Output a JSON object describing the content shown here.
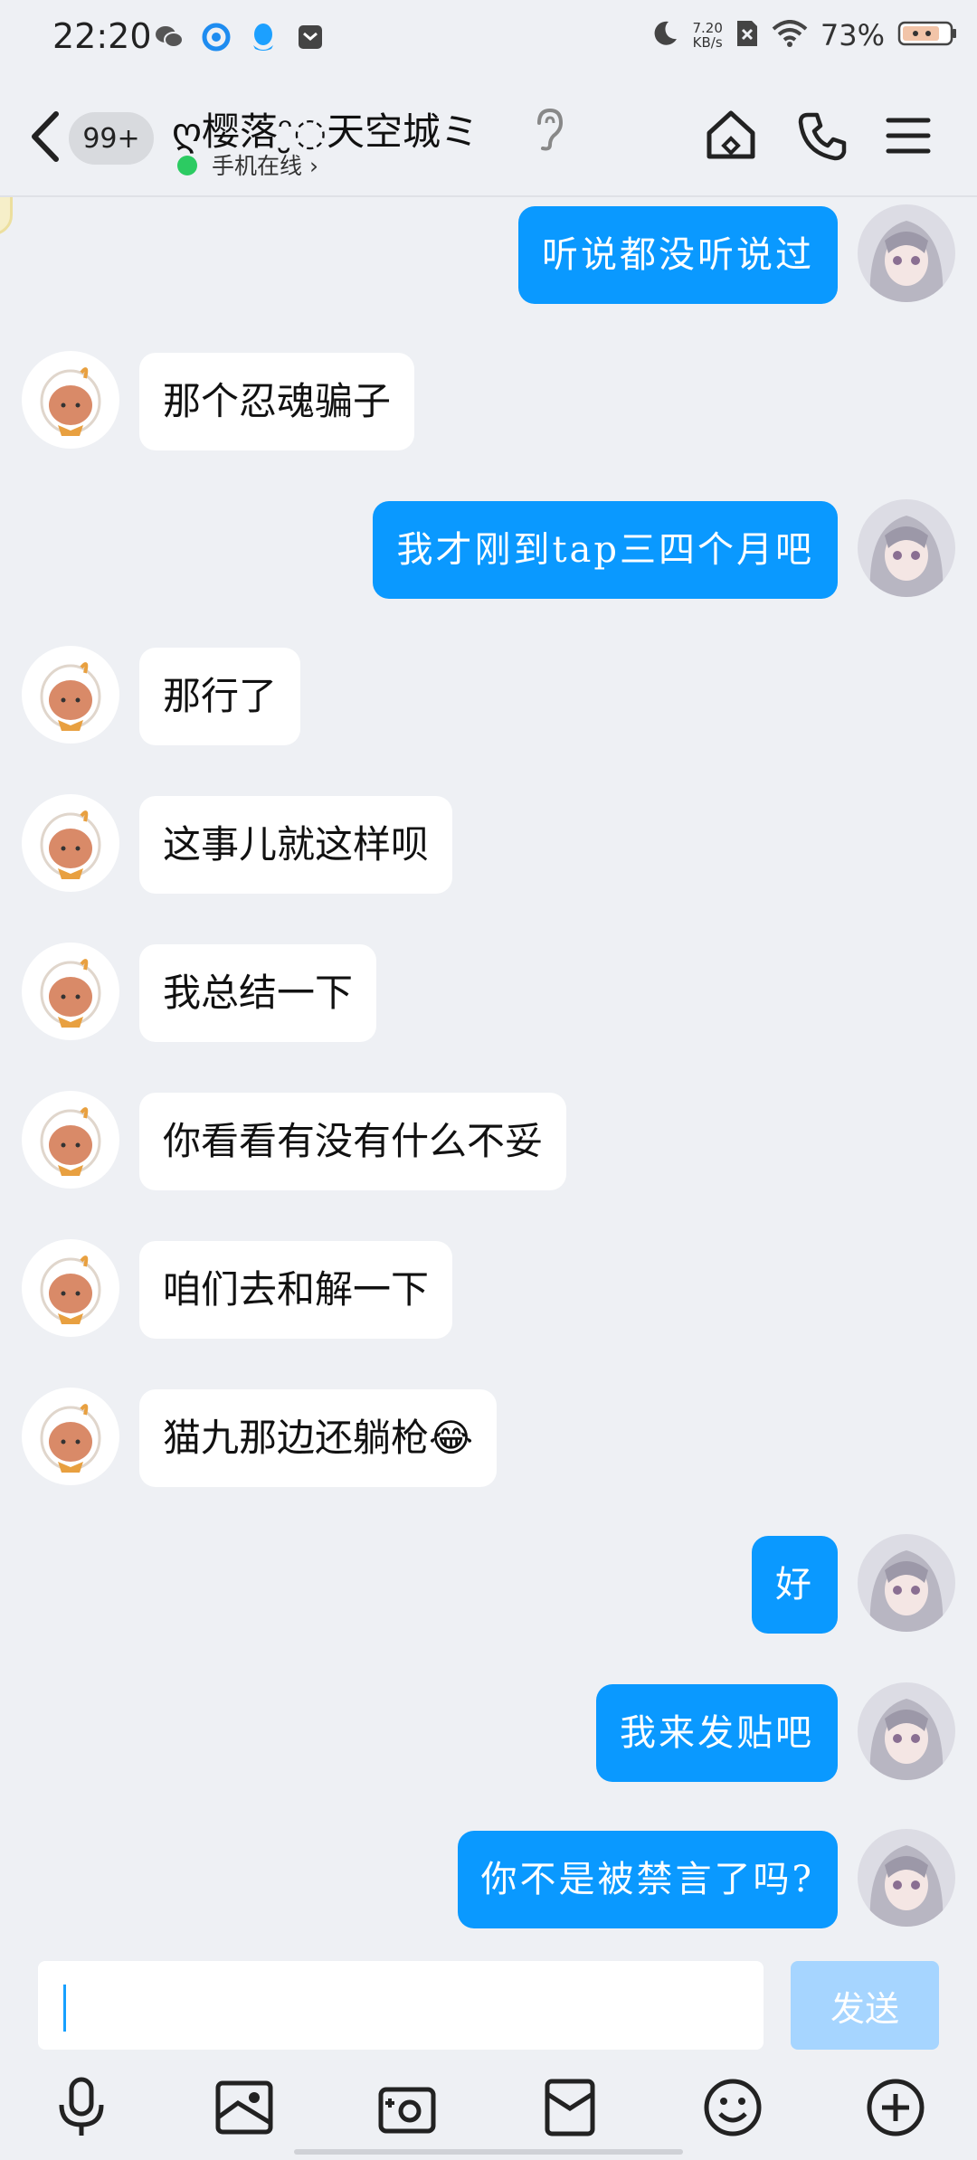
{
  "status_bar": {
    "time": "22:20",
    "net_speed_value": "7.20",
    "net_speed_unit": "KB/s",
    "battery": "73%"
  },
  "header": {
    "unread_count": "99+",
    "contact_name": "ღ樱落ᵔ̮◌天空城ミ",
    "online_status": "手机在线 ›"
  },
  "messages": [
    {
      "side": "out",
      "text": "听说都没听说过"
    },
    {
      "side": "in",
      "text": "那个忍魂骗子"
    },
    {
      "side": "out",
      "text": "我才刚到tap三四个月吧"
    },
    {
      "side": "in",
      "text": "那行了"
    },
    {
      "side": "in",
      "text": "这事儿就这样呗"
    },
    {
      "side": "in",
      "text": "我总结一下"
    },
    {
      "side": "in",
      "text": "你看看有没有什么不妥"
    },
    {
      "side": "in",
      "text": "咱们去和解一下"
    },
    {
      "side": "in",
      "text": "猫九那边还躺枪😂"
    },
    {
      "side": "out",
      "text": "好"
    },
    {
      "side": "out",
      "text": "我来发贴吧"
    },
    {
      "side": "out",
      "text": "你不是被禁言了吗?"
    }
  ],
  "input": {
    "value": "",
    "send_label": "发送"
  },
  "colors": {
    "outgoing_bubble": "#0a99ff",
    "send_disabled": "#a6d5ff",
    "online": "#2ccb62"
  },
  "icons": {
    "toolbar": [
      "microphone-icon",
      "image-icon",
      "camera-icon",
      "red-packet-icon",
      "emoji-icon",
      "plus-icon"
    ]
  }
}
